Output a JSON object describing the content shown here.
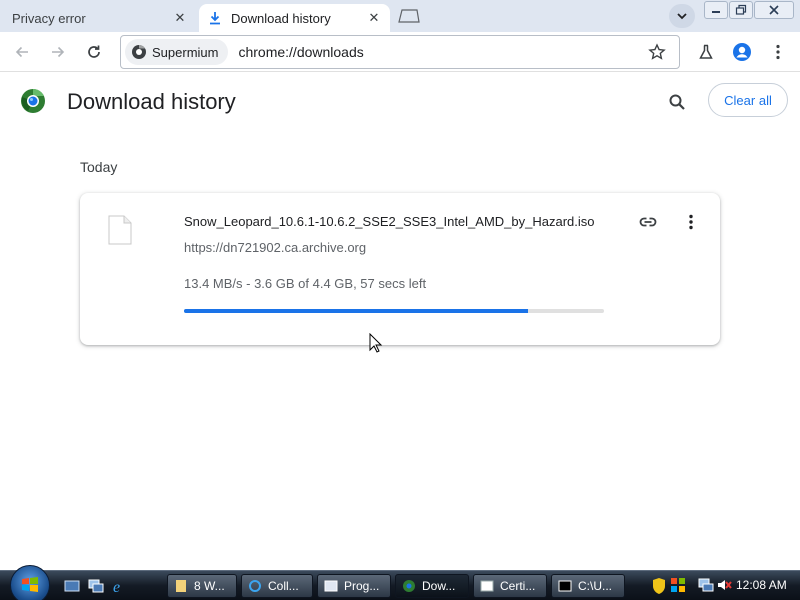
{
  "tabs": [
    {
      "title": "Privacy error",
      "active": false
    },
    {
      "title": "Download history",
      "active": true
    }
  ],
  "toolbar": {
    "site_chip": "Supermium",
    "url": "chrome://downloads"
  },
  "page": {
    "title": "Download history",
    "clear_all_label": "Clear all",
    "section_label": "Today"
  },
  "download": {
    "file_name": "Snow_Leopard_10.6.1-10.6.2_SSE2_SSE3_Intel_AMD_by_Hazard.iso",
    "url": "https://dn721902.ca.archive.org",
    "status": "13.4 MB/s - 3.6 GB of 4.4 GB, 57 secs left",
    "progress": 0.82
  },
  "taskbar": {
    "items": [
      {
        "label": "8 W...",
        "icon": "folder-icon"
      },
      {
        "label": "Coll...",
        "icon": "ie-icon"
      },
      {
        "label": "Prog...",
        "icon": "window-icon"
      },
      {
        "label": "Dow...",
        "icon": "browser-icon"
      },
      {
        "label": "Certi...",
        "icon": "cert-icon"
      },
      {
        "label": "C:\\U...",
        "icon": "cmd-icon"
      }
    ],
    "clock": "12:08 AM"
  },
  "colors": {
    "accent": "#1a73e8",
    "tabstrip": "#dfe6f1",
    "progress_track": "#e0e0e0"
  }
}
